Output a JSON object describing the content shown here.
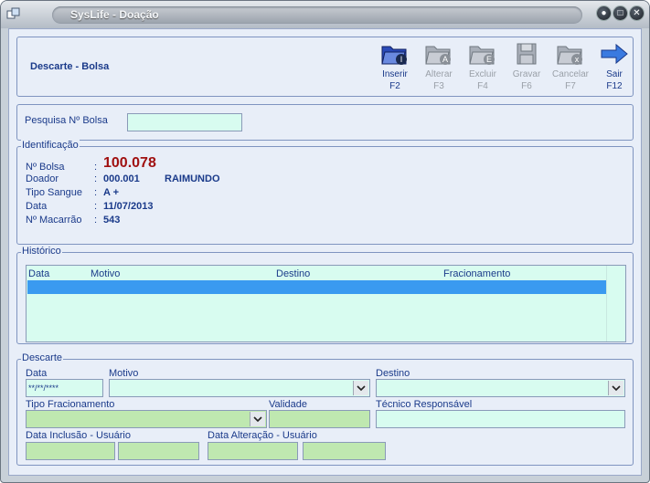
{
  "window": {
    "title": "SysLife - Doação"
  },
  "header": {
    "title": "Descarte - Bolsa"
  },
  "toolbar": {
    "inserir": {
      "label": "Inserir",
      "key": "F2"
    },
    "alterar": {
      "label": "Alterar",
      "key": "F3"
    },
    "excluir": {
      "label": "Excluir",
      "key": "F4"
    },
    "gravar": {
      "label": "Gravar",
      "key": "F6"
    },
    "cancelar": {
      "label": "Cancelar",
      "key": "F7"
    },
    "sair": {
      "label": "Sair",
      "key": "F12"
    }
  },
  "search": {
    "label": "Pesquisa Nº Bolsa",
    "value": ""
  },
  "identificacao": {
    "legend": "Identificação",
    "bolsa_label": "Nº Bolsa",
    "bolsa_value": "100.078",
    "doador_label": "Doador",
    "doador_code": "000.001",
    "doador_name": "RAIMUNDO",
    "tipo_label": "Tipo Sangue",
    "tipo_value": "A +",
    "data_label": "Data",
    "data_value": "11/07/2013",
    "macarrao_label": "Nº Macarrão",
    "macarrao_value": "543",
    "colon": ":"
  },
  "historico": {
    "legend": "Histórico",
    "columns": [
      "Data",
      "Motivo",
      "Destino",
      "Fracionamento"
    ]
  },
  "descarte": {
    "legend": "Descarte",
    "data_label": "Data",
    "data_value": "**/**/****",
    "motivo_label": "Motivo",
    "destino_label": "Destino",
    "tipo_frac_label": "Tipo Fracionamento",
    "validade_label": "Validade",
    "tecnico_label": "Técnico Responsável",
    "data_inclusao_label": "Data Inclusão - Usuário",
    "data_alteracao_label": "Data Alteração - Usuário"
  },
  "colors": {
    "accent": "#1a3a8a",
    "highlight": "#a01010",
    "field_mint": "#d8fcf0",
    "field_green": "#bfe8b0",
    "selection": "#3a9af0"
  }
}
